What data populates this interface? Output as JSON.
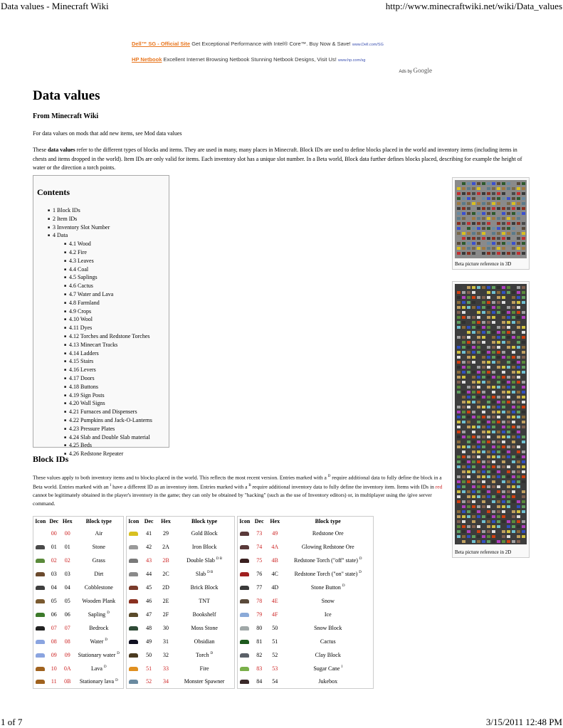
{
  "browser": {
    "page_title": "Data values - Minecraft Wiki",
    "url": "http://www.minecraftwiki.net/wiki/Data_values",
    "page_counter": "1 of 7",
    "print_timestamp": "3/15/2011 12:48 PM"
  },
  "ads": {
    "items": [
      {
        "link": "Dell™ SG - Official Site",
        "text": "Get Exceptional Performance with Intel® Core™. Buy Now & Save!",
        "url": "www.Dell.com/SG"
      },
      {
        "link": "HP Netbook",
        "text": "Excellent Internet Browsing Netbook Stunning Netbook Designs, Visit Us!",
        "url": "www.hp.com/sg"
      }
    ],
    "ads_by": "Ads by",
    "ads_brand": "Google"
  },
  "article": {
    "title": "Data values",
    "from": "From Minecraft Wiki",
    "mod_note": "For data values on mods that add new items, see Mod data values",
    "intro_prefix": "These ",
    "intro_bold": "data values",
    "intro_rest": " refer to the different types of blocks and items. They are used in many, many places in Minecraft. Block IDs are used to define blocks placed in the world and inventory items (including items in chests and items dropped in the world). Item IDs are only valid for items. Each inventory slot has a unique slot number. In a Beta world, Block data further defines blocks placed, describing for example the height of water or the direction a torch points."
  },
  "toc": {
    "title": "Contents",
    "items": [
      {
        "label": "1 Block IDs",
        "level": 1
      },
      {
        "label": "2 Item IDs",
        "level": 1
      },
      {
        "label": "3 Inventory Slot Number",
        "level": 1
      },
      {
        "label": "4 Data",
        "level": 1
      },
      {
        "label": "4.1 Wood",
        "level": 2
      },
      {
        "label": "4.2 Fire",
        "level": 2
      },
      {
        "label": "4.3 Leaves",
        "level": 2
      },
      {
        "label": "4.4 Coal",
        "level": 2
      },
      {
        "label": "4.5 Saplings",
        "level": 2
      },
      {
        "label": "4.6 Cactus",
        "level": 2
      },
      {
        "label": "4.7 Water and Lava",
        "level": 2
      },
      {
        "label": "4.8 Farmland",
        "level": 2
      },
      {
        "label": "4.9 Crops",
        "level": 2
      },
      {
        "label": "4.10 Wool",
        "level": 2
      },
      {
        "label": "4.11 Dyes",
        "level": 2
      },
      {
        "label": "4.12 Torches and Redstone Torches",
        "level": 2
      },
      {
        "label": "4.13 Minecart Tracks",
        "level": 2
      },
      {
        "label": "4.14 Ladders",
        "level": 2
      },
      {
        "label": "4.15 Stairs",
        "level": 2
      },
      {
        "label": "4.16 Levers",
        "level": 2
      },
      {
        "label": "4.17 Doors",
        "level": 2
      },
      {
        "label": "4.18 Buttons",
        "level": 2
      },
      {
        "label": "4.19 Sign Posts",
        "level": 2
      },
      {
        "label": "4.20 Wall Signs",
        "level": 2
      },
      {
        "label": "4.21 Furnaces and Dispensers",
        "level": 2
      },
      {
        "label": "4.22 Pumpkins and Jack-O-Lanterns",
        "level": 2
      },
      {
        "label": "4.23 Pressure Plates",
        "level": 2
      },
      {
        "label": "4.24 Slab and Double Slab material",
        "level": 2
      },
      {
        "label": "4.25 Beds",
        "level": 2
      },
      {
        "label": "4.26 Redstone Repeater",
        "level": 2
      }
    ]
  },
  "thumbnails": [
    {
      "caption": "Beta picture reference in 3D"
    },
    {
      "caption": "Beta picture reference in 2D"
    }
  ],
  "block_ids": {
    "heading": "Block IDs",
    "desc_1": "These values apply to both inventory items and to blocks placed in the world. This reflects the most recent version. Entries marked with a ",
    "sup_d": "D",
    "desc_2": " require additional data to fully define the block in a Beta world. Entries marked with an ",
    "sup_i": "I",
    "desc_3": " have a different ID as an inventory item. Entries marked with a ",
    "sup_b": "B",
    "desc_4": " require additional inventory data to fully define the inventory item. Items with IDs in ",
    "desc_red": "red",
    "desc_5": " cannot be legitimately obtained in the player's inventory in the game; they can only be obtained by \"hacking\" (such as the use of Inventory editors) or, in multiplayer using the /give server command.",
    "columns": [
      "Icon",
      "Dec",
      "Hex",
      "Block type"
    ],
    "red_color": "#cc2222",
    "tables": [
      [
        {
          "icon": "",
          "dec": "00",
          "hex": "00",
          "name": "Air",
          "sup": "",
          "red": true
        },
        {
          "icon": "#4a4a4a",
          "dec": "01",
          "hex": "01",
          "name": "Stone",
          "sup": "",
          "red": false
        },
        {
          "icon": "#5a8a3a",
          "dec": "02",
          "hex": "02",
          "name": "Grass",
          "sup": "",
          "red": true
        },
        {
          "icon": "#6b4a2e",
          "dec": "03",
          "hex": "03",
          "name": "Dirt",
          "sup": "",
          "red": false
        },
        {
          "icon": "#3e3e3e",
          "dec": "04",
          "hex": "04",
          "name": "Cobblestone",
          "sup": "",
          "red": false
        },
        {
          "icon": "#7a5a30",
          "dec": "05",
          "hex": "05",
          "name": "Wooden Plank",
          "sup": "",
          "red": false
        },
        {
          "icon": "#3c7a2a",
          "dec": "06",
          "hex": "06",
          "name": "Sapling",
          "sup": "D",
          "red": false
        },
        {
          "icon": "#222222",
          "dec": "07",
          "hex": "07",
          "name": "Bedrock",
          "sup": "",
          "red": true
        },
        {
          "icon": "#8aa4e0",
          "dec": "08",
          "hex": "08",
          "name": "Water",
          "sup": "D",
          "red": true
        },
        {
          "icon": "#8aa4e0",
          "dec": "09",
          "hex": "09",
          "name": "Stationary water",
          "sup": "D",
          "red": true
        },
        {
          "icon": "#a0621e",
          "dec": "10",
          "hex": "0A",
          "name": "Lava",
          "sup": "D",
          "red": true
        },
        {
          "icon": "#a0621e",
          "dec": "11",
          "hex": "0B",
          "name": "Stationary lava",
          "sup": "D",
          "red": true
        }
      ],
      [
        {
          "icon": "#d8c020",
          "dec": "41",
          "hex": "29",
          "name": "Gold Block",
          "sup": "",
          "red": false
        },
        {
          "icon": "#9a9a9a",
          "dec": "42",
          "hex": "2A",
          "name": "Iron Block",
          "sup": "",
          "red": false
        },
        {
          "icon": "#7a7a7a",
          "dec": "43",
          "hex": "2B",
          "name": "Double Slab",
          "sup": "D B",
          "red": true
        },
        {
          "icon": "#8a8a8a",
          "dec": "44",
          "hex": "2C",
          "name": "Slab",
          "sup": "D B",
          "red": false
        },
        {
          "icon": "#7a3a2a",
          "dec": "45",
          "hex": "2D",
          "name": "Brick Block",
          "sup": "",
          "red": false
        },
        {
          "icon": "#8a3020",
          "dec": "46",
          "hex": "2E",
          "name": "TNT",
          "sup": "",
          "red": false
        },
        {
          "icon": "#5a4a2a",
          "dec": "47",
          "hex": "2F",
          "name": "Bookshelf",
          "sup": "",
          "red": false
        },
        {
          "icon": "#2e4a36",
          "dec": "48",
          "hex": "30",
          "name": "Moss Stone",
          "sup": "",
          "red": false
        },
        {
          "icon": "#111122",
          "dec": "49",
          "hex": "31",
          "name": "Obsidian",
          "sup": "",
          "red": false
        },
        {
          "icon": "#4a3a20",
          "dec": "50",
          "hex": "32",
          "name": "Torch",
          "sup": "D",
          "red": false
        },
        {
          "icon": "#e09020",
          "dec": "51",
          "hex": "33",
          "name": "Fire",
          "sup": "",
          "red": true
        },
        {
          "icon": "#6a8aa0",
          "dec": "52",
          "hex": "34",
          "name": "Monster Spawner",
          "sup": "",
          "red": true
        }
      ],
      [
        {
          "icon": "#5a3a3a",
          "dec": "73",
          "hex": "49",
          "name": "Redstone Ore",
          "sup": "",
          "red": true
        },
        {
          "icon": "#5a3a3a",
          "dec": "74",
          "hex": "4A",
          "name": "Glowing Redstone Ore",
          "sup": "",
          "red": true
        },
        {
          "icon": "#3a2020",
          "dec": "75",
          "hex": "4B",
          "name": "Redstone Torch (\"off\" state)",
          "sup": "D",
          "red": true
        },
        {
          "icon": "#a02020",
          "dec": "76",
          "hex": "4C",
          "name": "Redstone Torch (\"on\" state)",
          "sup": "D",
          "red": false
        },
        {
          "icon": "#3a3a3a",
          "dec": "77",
          "hex": "4D",
          "name": "Stone Button",
          "sup": "D",
          "red": false
        },
        {
          "icon": "#5a4a3a",
          "dec": "78",
          "hex": "4E",
          "name": "Snow",
          "sup": "",
          "red": true
        },
        {
          "icon": "#8aaad8",
          "dec": "79",
          "hex": "4F",
          "name": "Ice",
          "sup": "",
          "red": true
        },
        {
          "icon": "#a0a8a8",
          "dec": "80",
          "hex": "50",
          "name": "Snow Block",
          "sup": "",
          "red": false
        },
        {
          "icon": "#1e5a1e",
          "dec": "81",
          "hex": "51",
          "name": "Cactus",
          "sup": "",
          "red": false
        },
        {
          "icon": "#5a6068",
          "dec": "82",
          "hex": "52",
          "name": "Clay Block",
          "sup": "",
          "red": false
        },
        {
          "icon": "#7ab04a",
          "dec": "83",
          "hex": "53",
          "name": "Sugar Cane",
          "sup": "I",
          "red": true
        },
        {
          "icon": "#3a2a2a",
          "dec": "84",
          "hex": "54",
          "name": "Jukebox",
          "sup": "",
          "red": false
        }
      ]
    ]
  }
}
